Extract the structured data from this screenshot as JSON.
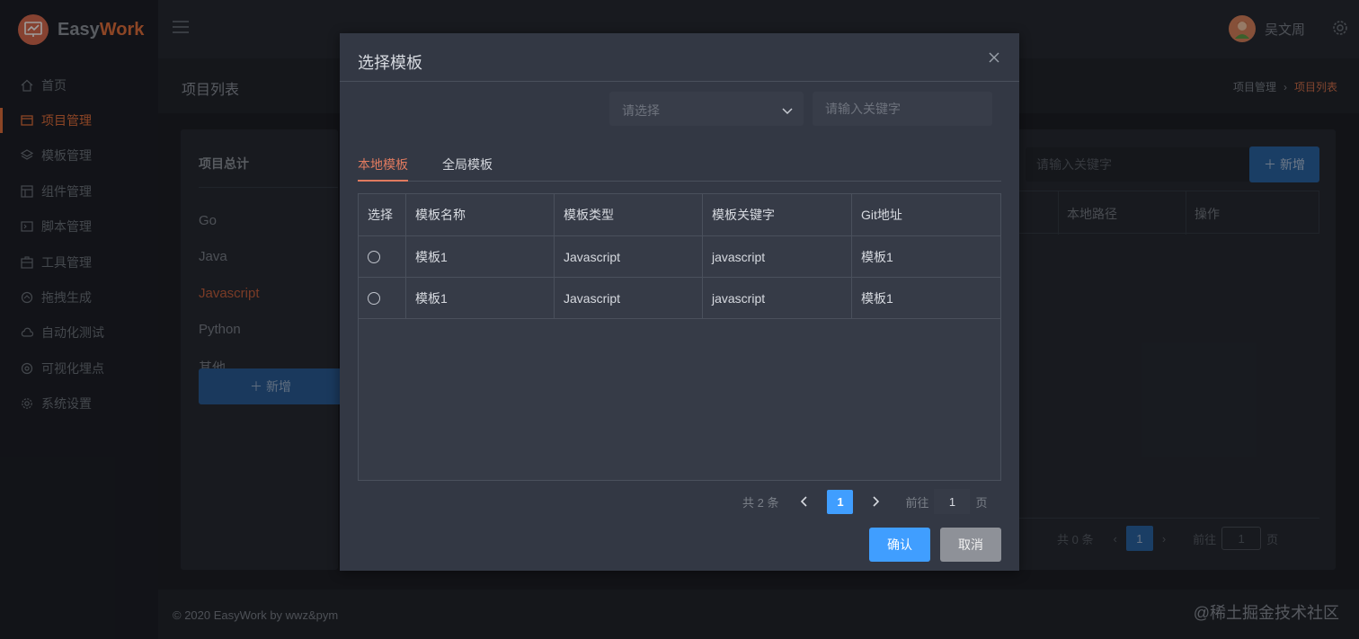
{
  "app": {
    "logo_prefix": "Easy",
    "logo_accent": "Work",
    "brand_color": "#e3703d",
    "primary_color": "#409eff"
  },
  "sidebar": {
    "items": [
      {
        "label": "首页",
        "icon": "home-icon"
      },
      {
        "label": "项目管理",
        "icon": "folder-icon"
      },
      {
        "label": "模板管理",
        "icon": "layers-icon"
      },
      {
        "label": "组件管理",
        "icon": "component-icon"
      },
      {
        "label": "脚本管理",
        "icon": "script-icon"
      },
      {
        "label": "工具管理",
        "icon": "toolbox-icon"
      },
      {
        "label": "拖拽生成",
        "icon": "drag-icon"
      },
      {
        "label": "自动化测试",
        "icon": "cloud-icon"
      },
      {
        "label": "可视化埋点",
        "icon": "target-icon"
      },
      {
        "label": "系统设置",
        "icon": "gear-icon"
      }
    ],
    "active_index": 1
  },
  "header": {
    "username": "吴文周"
  },
  "titlebar": {
    "title": "项目列表",
    "breadcrumb": [
      "项目管理",
      "项目列表"
    ]
  },
  "categories": {
    "title": "项目总计",
    "items": [
      "Go",
      "Java",
      "Javascript",
      "Python",
      "其他"
    ],
    "active_index": 2,
    "add_label": "新增"
  },
  "projects": {
    "search_placeholder": "请输入关键字",
    "add_label": "新增",
    "columns": [
      "本地路径",
      "操作"
    ],
    "pager": {
      "total": "共 0 条",
      "page": "1",
      "goto": "前往",
      "jump": "1",
      "page_unit": "页"
    }
  },
  "footer": {
    "copyright": "© 2020 EasyWork by wwz&pym",
    "watermark": "@稀土掘金技术社区"
  },
  "dialog": {
    "title": "选择模板",
    "select_placeholder": "请选择",
    "keyword_placeholder": "请输入关键字",
    "tabs": [
      "本地模板",
      "全局模板"
    ],
    "active_tab": 0,
    "columns": [
      "选择",
      "模板名称",
      "模板类型",
      "模板关键字",
      "Git地址"
    ],
    "rows": [
      {
        "name": "模板1",
        "type": "Javascript",
        "keyword": "javascript",
        "git": "模板1"
      },
      {
        "name": "模板1",
        "type": "Javascript",
        "keyword": "javascript",
        "git": "模板1"
      }
    ],
    "pager": {
      "total": "共 2 条",
      "page": "1",
      "goto": "前往",
      "jump": "1",
      "page_unit": "页"
    },
    "ok_label": "确认",
    "cancel_label": "取消"
  }
}
